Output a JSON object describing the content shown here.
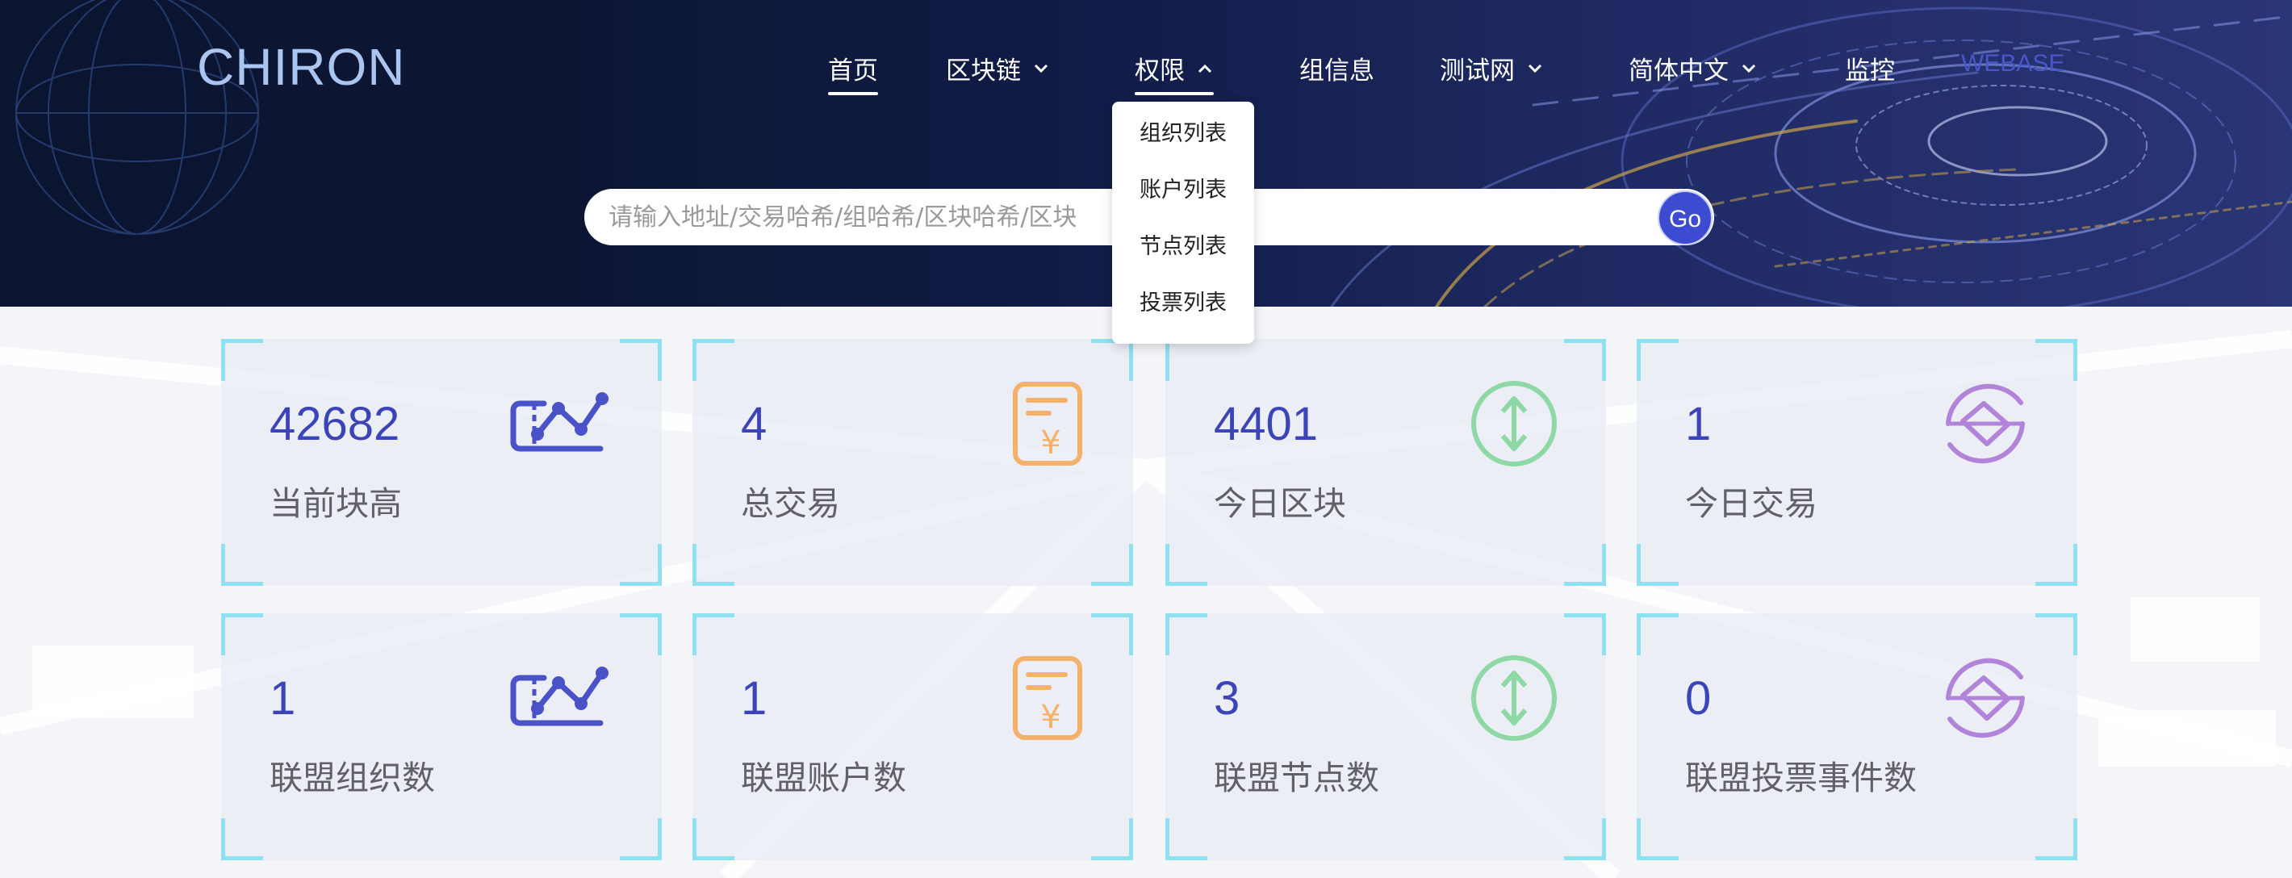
{
  "header": {
    "logo": "CHIRON",
    "nav": [
      {
        "label": "首页",
        "name": "nav-home"
      },
      {
        "label": "区块链",
        "name": "nav-blockchain"
      },
      {
        "label": "权限",
        "name": "nav-permissions"
      },
      {
        "label": "组信息",
        "name": "nav-group-info"
      },
      {
        "label": "测试网",
        "name": "nav-testnet"
      },
      {
        "label": "简体中文",
        "name": "nav-language"
      },
      {
        "label": "监控",
        "name": "nav-monitor"
      },
      {
        "label": "WEBASE",
        "name": "nav-webase"
      }
    ],
    "permissions_menu": [
      "组织列表",
      "账户列表",
      "节点列表",
      "投票列表"
    ],
    "search": {
      "placeholder": "请输入地址/交易哈希/组哈希/区块哈希/区块",
      "value": "",
      "go_label": "Go"
    }
  },
  "stats": [
    {
      "value": "42682",
      "label": "当前块高",
      "icon": "chart-line-icon"
    },
    {
      "value": "4",
      "label": "总交易",
      "icon": "receipt-yen-icon"
    },
    {
      "value": "4401",
      "label": "今日区块",
      "icon": "vertical-arrows-icon"
    },
    {
      "value": "1",
      "label": "今日交易",
      "icon": "exchange-diamond-icon"
    },
    {
      "value": "1",
      "label": "联盟组织数",
      "icon": "chart-line-icon"
    },
    {
      "value": "1",
      "label": "联盟账户数",
      "icon": "receipt-yen-icon"
    },
    {
      "value": "3",
      "label": "联盟节点数",
      "icon": "vertical-arrows-icon"
    },
    {
      "value": "0",
      "label": "联盟投票事件数",
      "icon": "exchange-diamond-icon"
    }
  ],
  "colors": {
    "accent": "#3d4bd0",
    "value_text": "#3b45b8",
    "chart_icon": "#4a52c8",
    "receipt_icon": "#f4b16b",
    "arrows_icon": "#8ed8a6",
    "exchange_icon": "#b184d9",
    "card_corner": "#8fe0f0"
  }
}
